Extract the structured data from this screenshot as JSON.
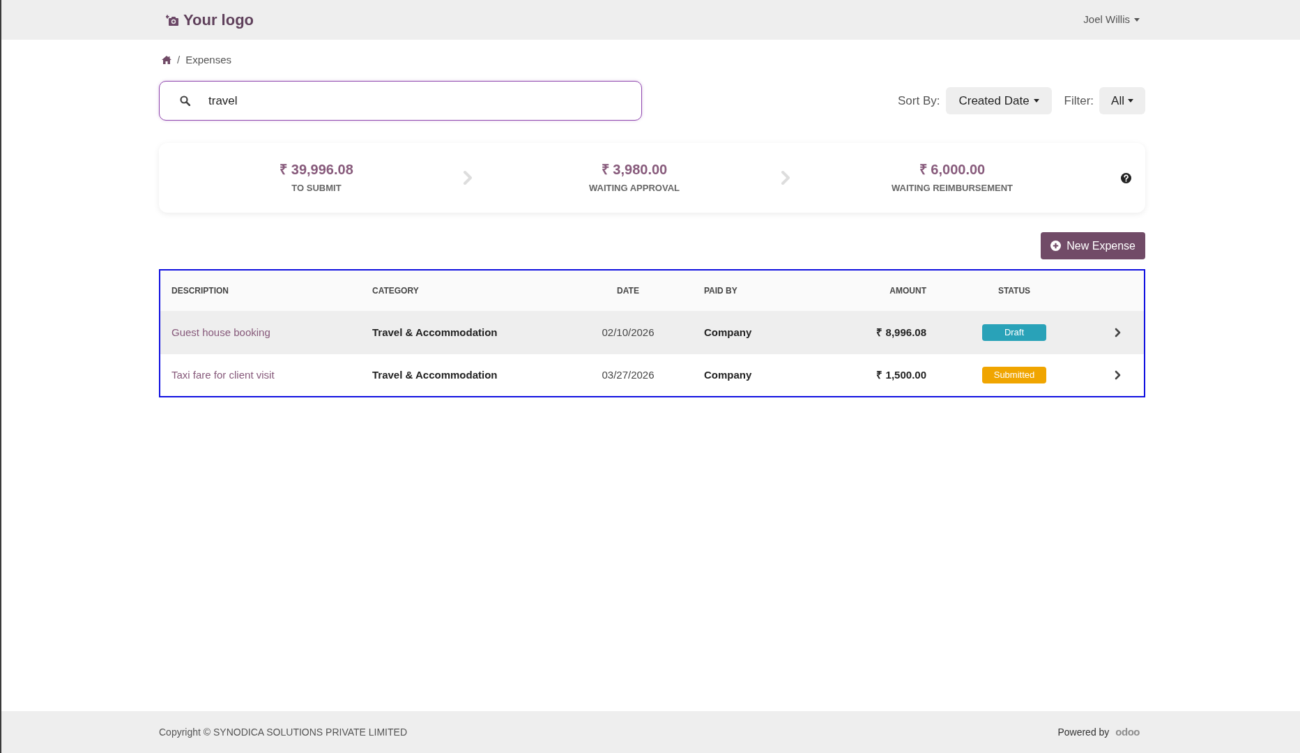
{
  "header": {
    "logo_text": "Your logo",
    "user_name": "Joel Willis"
  },
  "breadcrumb": {
    "separator": "/",
    "current": "Expenses"
  },
  "search": {
    "value": "travel"
  },
  "sort": {
    "label": "Sort By:",
    "value": "Created Date"
  },
  "filter": {
    "label": "Filter:",
    "value": "All"
  },
  "summary": [
    {
      "amount": "₹ 39,996.08",
      "label": "TO SUBMIT"
    },
    {
      "amount": "₹ 3,980.00",
      "label": "WAITING APPROVAL"
    },
    {
      "amount": "₹ 6,000.00",
      "label": "WAITING REIMBURSEMENT"
    }
  ],
  "new_expense_button": "New Expense",
  "table": {
    "columns": [
      "DESCRIPTION",
      "CATEGORY",
      "DATE",
      "PAID BY",
      "AMOUNT",
      "STATUS"
    ],
    "rows": [
      {
        "description": "Guest house booking",
        "category": "Travel & Accommodation",
        "date": "02/10/2026",
        "paid_by": "Company",
        "amount": "₹ 8,996.08",
        "status": {
          "label": "Draft",
          "color": "#29a2b8"
        }
      },
      {
        "description": "Taxi fare for client visit",
        "category": "Travel & Accommodation",
        "date": "03/27/2026",
        "paid_by": "Company",
        "amount": "₹ 1,500.00",
        "status": {
          "label": "Submitted",
          "color": "#f0a500"
        }
      }
    ]
  },
  "footer": {
    "copyright": "Copyright © SYNODICA SOLUTIONS PRIVATE LIMITED",
    "powered_by": "Powered by",
    "brand": "odoo"
  }
}
